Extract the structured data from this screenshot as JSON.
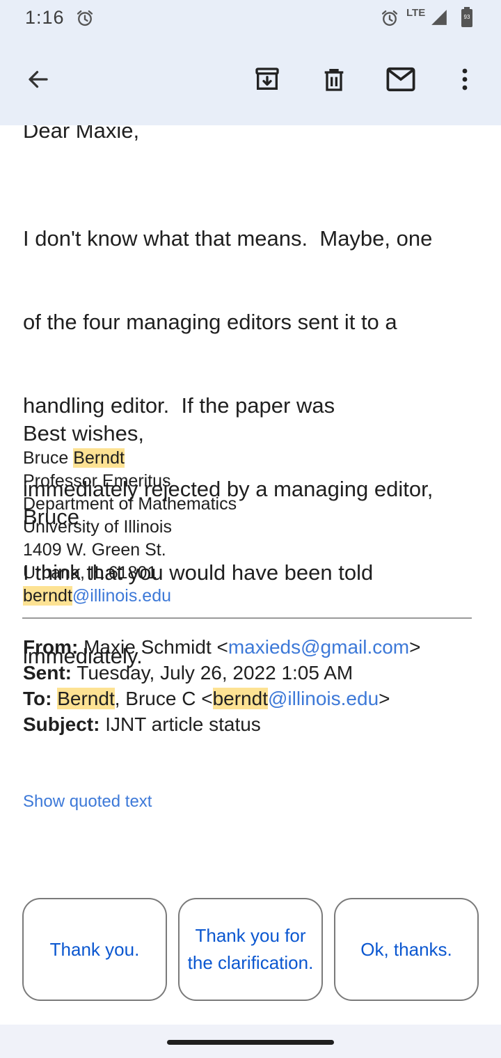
{
  "status_bar": {
    "time": "1:16",
    "network": "LTE",
    "battery_level": "93"
  },
  "app_bar": {
    "icons": [
      "back-arrow-icon",
      "archive-icon",
      "delete-icon",
      "mark-unread-icon",
      "more-vert-icon"
    ]
  },
  "email": {
    "greeting": "Dear Maxie,",
    "paragraph_lines": [
      "I don't know what that means.  Maybe, one",
      "of the four managing editors sent it to a",
      "handling editor.  If the paper was",
      "immediately rejected by a managing editor,",
      "I think that you would have been told",
      "immediately."
    ],
    "closing": "Best wishes,",
    "closing_name": "Bruce",
    "signature": {
      "name_first": "Bruce",
      "name_last": "Berndt",
      "title": "Professor Emeritus",
      "department": "Department of Mathematics",
      "university": "University of Illinois",
      "street": "1409 W. Green St.",
      "city": "Urbana, IL 61801",
      "email_user": "berndt",
      "email_domain": "@illinois.edu"
    },
    "quoted_header": {
      "from_label": "From:",
      "from_name": "Maxie Schmidt <",
      "from_email": "maxieds@gmail.com",
      "from_close": ">",
      "sent_label": "Sent:",
      "sent_value": "Tuesday, July 26, 2022 1:05 AM",
      "to_label": "To:",
      "to_last": "Berndt",
      "to_rest": ", Bruce C <",
      "to_email_user": "berndt",
      "to_email_domain": "@illinois.edu",
      "to_close": ">",
      "subject_label": "Subject:",
      "subject_value": "IJNT article status"
    },
    "show_quoted_text": "Show quoted text"
  },
  "smart_replies": [
    "Thank you.",
    "Thank you for the clarification.",
    "Ok, thanks."
  ],
  "colors": {
    "app_bar_bg": "#e8eef8",
    "link": "#3d79d8",
    "highlight": "#fde293",
    "smart_reply_text": "#0b57d0"
  }
}
